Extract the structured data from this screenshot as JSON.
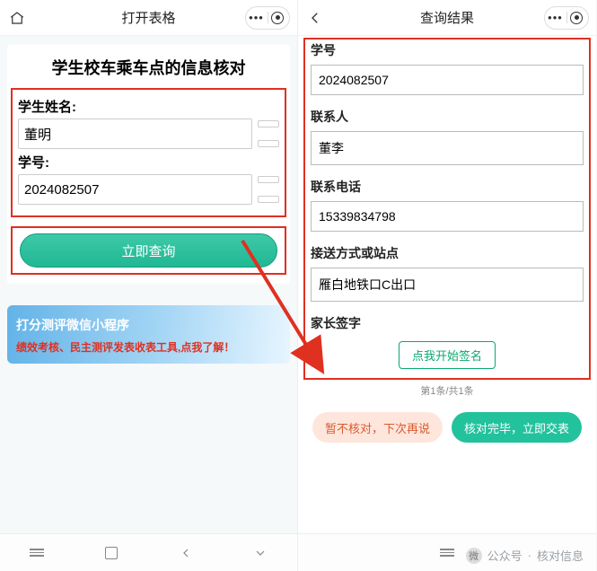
{
  "left": {
    "header": {
      "title": "打开表格"
    },
    "form": {
      "title": "学生校车乘车点的信息核对",
      "name_label": "学生姓名:",
      "name_value": "董明",
      "id_label": "学号:",
      "id_value": "2024082507",
      "query_btn": "立即查询"
    },
    "ad": {
      "line1": "打分测评微信小程序",
      "line2": "绩效考核、民主测评发表收表工具,点我了解！"
    }
  },
  "right": {
    "header": {
      "title": "查询结果"
    },
    "sections": {
      "id_label": "学号",
      "id_value": "2024082507",
      "contact_label": "联系人",
      "contact_value": "董李",
      "phone_label": "联系电话",
      "phone_value": "15339834798",
      "station_label": "接送方式或站点",
      "station_value": "雁白地铁口C出口",
      "sign_label": "家长签字",
      "sign_btn": "点我开始签名"
    },
    "pager": "第1条/共1条",
    "actions": {
      "skip": "暂不核对，下次再说",
      "submit": "核对完毕，立即交表"
    }
  },
  "watermark": {
    "prefix": "公众号",
    "dot": "·",
    "name": "核对信息"
  }
}
